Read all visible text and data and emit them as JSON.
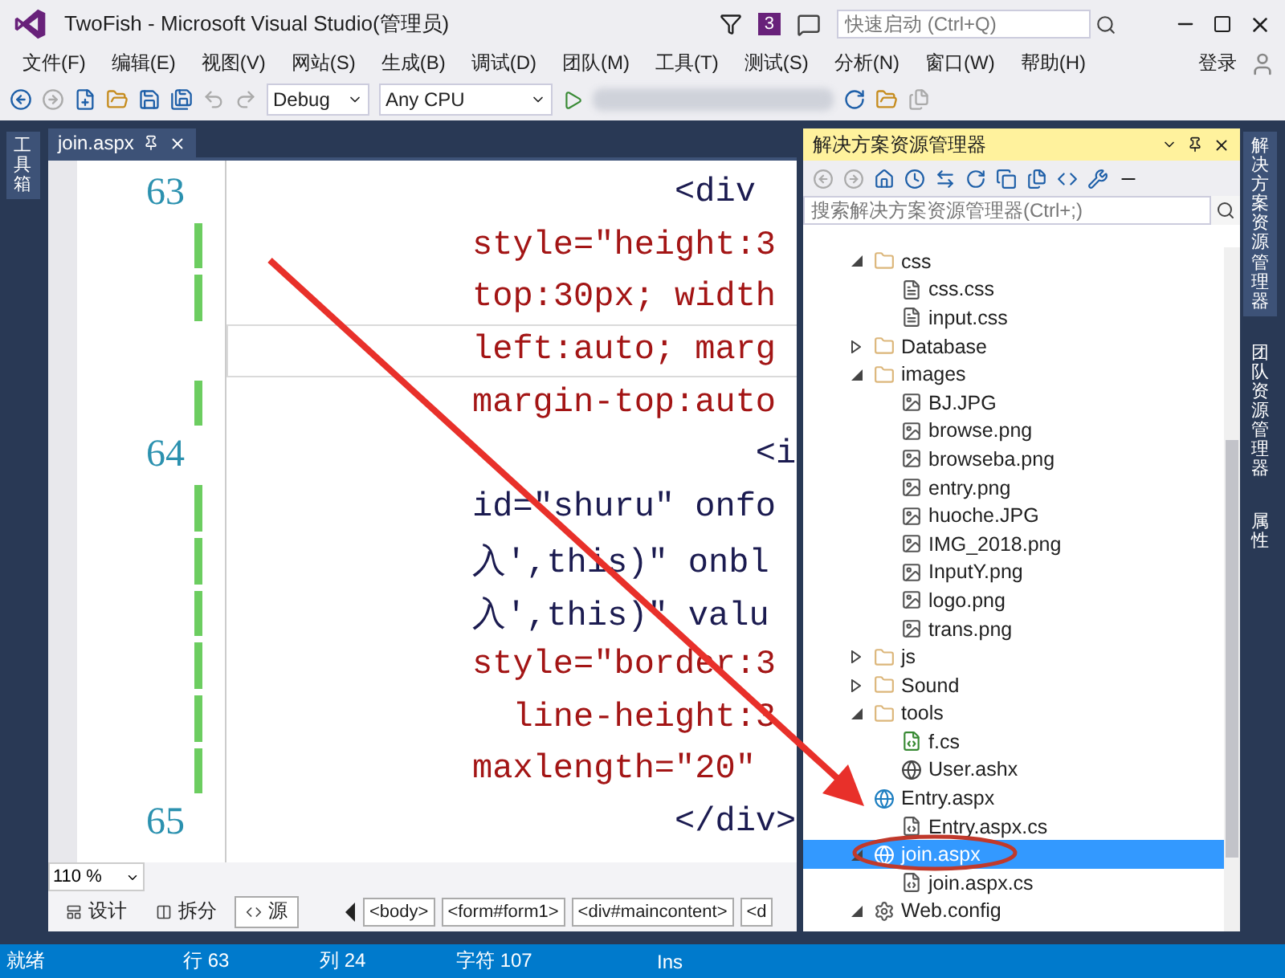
{
  "window": {
    "title": "TwoFish - Microsoft Visual Studio(管理员)",
    "notification_count": "3",
    "quick_launch": {
      "placeholder": "快速启动 (Ctrl+Q)"
    }
  },
  "menu": [
    "文件(F)",
    "编辑(E)",
    "视图(V)",
    "网站(S)",
    "生成(B)",
    "调试(D)",
    "团队(M)",
    "工具(T)",
    "测试(S)",
    "分析(N)",
    "窗口(W)",
    "帮助(H)"
  ],
  "sign_in": "登录",
  "toolbar": {
    "configuration": "Debug",
    "platform": "Any CPU"
  },
  "toolbox_tab": "工具箱",
  "editor": {
    "tab": {
      "label": "join.aspx",
      "selected": true
    },
    "lines": [
      {
        "number": "63",
        "text": "          <div",
        "kind": "markup",
        "changed": false,
        "current": false
      },
      {
        "text": "style=\"height:3",
        "kind": "attribute",
        "changed": true,
        "current": false
      },
      {
        "text": "top:30px; width",
        "kind": "attribute",
        "changed": true,
        "current": false
      },
      {
        "text": "left:auto; marg",
        "kind": "attribute",
        "changed": false,
        "current": true
      },
      {
        "text": "margin-top:auto",
        "kind": "attribute",
        "changed": true,
        "current": false
      },
      {
        "number": "64",
        "text": "              <i",
        "kind": "markup",
        "changed": false,
        "current": false
      },
      {
        "text": "id=\"shuru\" onfo",
        "kind": "markup",
        "changed": true,
        "current": false
      },
      {
        "text": "入',this)\" onbl",
        "kind": "markup",
        "changed": true,
        "current": false
      },
      {
        "text": "入',this)\" valu",
        "kind": "markup",
        "changed": true,
        "current": false
      },
      {
        "text": "style=\"border:3",
        "kind": "attribute",
        "changed": true,
        "current": false
      },
      {
        "text": "  line-height:3",
        "kind": "attribute",
        "changed": true,
        "current": false
      },
      {
        "text": "maxlength=\"20\"",
        "kind": "attribute",
        "changed": true,
        "current": false
      },
      {
        "number": "65",
        "text": "          </div>",
        "kind": "markup",
        "changed": false,
        "current": false
      }
    ],
    "zoom": "110 %",
    "views": [
      {
        "label": "设计",
        "kind": "design",
        "selected": false
      },
      {
        "label": "拆分",
        "kind": "split",
        "selected": false
      },
      {
        "label": "源",
        "kind": "source",
        "selected": true
      }
    ],
    "breadcrumbs": [
      "<body>",
      "<form#form1>",
      "<div#maincontent>",
      "<d"
    ]
  },
  "solution_explorer": {
    "title": "解决方案资源管理器",
    "search": {
      "placeholder": "搜索解决方案资源管理器(Ctrl+;)"
    },
    "tree": [
      {
        "label": "css",
        "kind": "folder",
        "expanded": true,
        "selected": false,
        "children": [
          {
            "label": "css.css",
            "kind": "style",
            "selected": false
          },
          {
            "label": "input.css",
            "kind": "style",
            "selected": false
          }
        ]
      },
      {
        "label": "Database",
        "kind": "folder",
        "expanded": false,
        "selected": false
      },
      {
        "label": "images",
        "kind": "folder",
        "expanded": true,
        "selected": false,
        "children": [
          {
            "label": "BJ.JPG",
            "kind": "image",
            "selected": false
          },
          {
            "label": "browse.png",
            "kind": "image",
            "selected": false
          },
          {
            "label": "browseba.png",
            "kind": "image",
            "selected": false
          },
          {
            "label": "entry.png",
            "kind": "image",
            "selected": false
          },
          {
            "label": "huoche.JPG",
            "kind": "image",
            "selected": false
          },
          {
            "label": "IMG_2018.png",
            "kind": "image",
            "selected": false
          },
          {
            "label": "InputY.png",
            "kind": "image",
            "selected": false
          },
          {
            "label": "logo.png",
            "kind": "image",
            "selected": false
          },
          {
            "label": "trans.png",
            "kind": "image",
            "selected": false
          }
        ]
      },
      {
        "label": "js",
        "kind": "folder",
        "expanded": false,
        "selected": false
      },
      {
        "label": "Sound",
        "kind": "folder",
        "expanded": false,
        "selected": false
      },
      {
        "label": "tools",
        "kind": "folder",
        "expanded": true,
        "selected": false,
        "children": [
          {
            "label": "f.cs",
            "kind": "csharp",
            "selected": false
          },
          {
            "label": "User.ashx",
            "kind": "handler",
            "selected": false
          }
        ]
      },
      {
        "label": "Entry.aspx",
        "kind": "page",
        "selected": false,
        "children": [
          {
            "label": "Entry.aspx.cs",
            "kind": "codebehind",
            "selected": false
          }
        ]
      },
      {
        "label": "join.aspx",
        "kind": "page",
        "expanded": true,
        "selected": true,
        "children": [
          {
            "label": "join.aspx.cs",
            "kind": "codebehind",
            "selected": false
          }
        ]
      },
      {
        "label": "Web.config",
        "kind": "config",
        "expanded": true,
        "selected": false
      }
    ]
  },
  "side_tabs": [
    {
      "label": "解决方案资源管理器",
      "selected": true
    },
    {
      "label": "团队资源管理器",
      "selected": false
    },
    {
      "label": "属性",
      "selected": false
    }
  ],
  "status_bar": {
    "message": "就绪",
    "line": "行 63",
    "column": "列 24",
    "char": "字符 107",
    "mode": "Ins"
  }
}
